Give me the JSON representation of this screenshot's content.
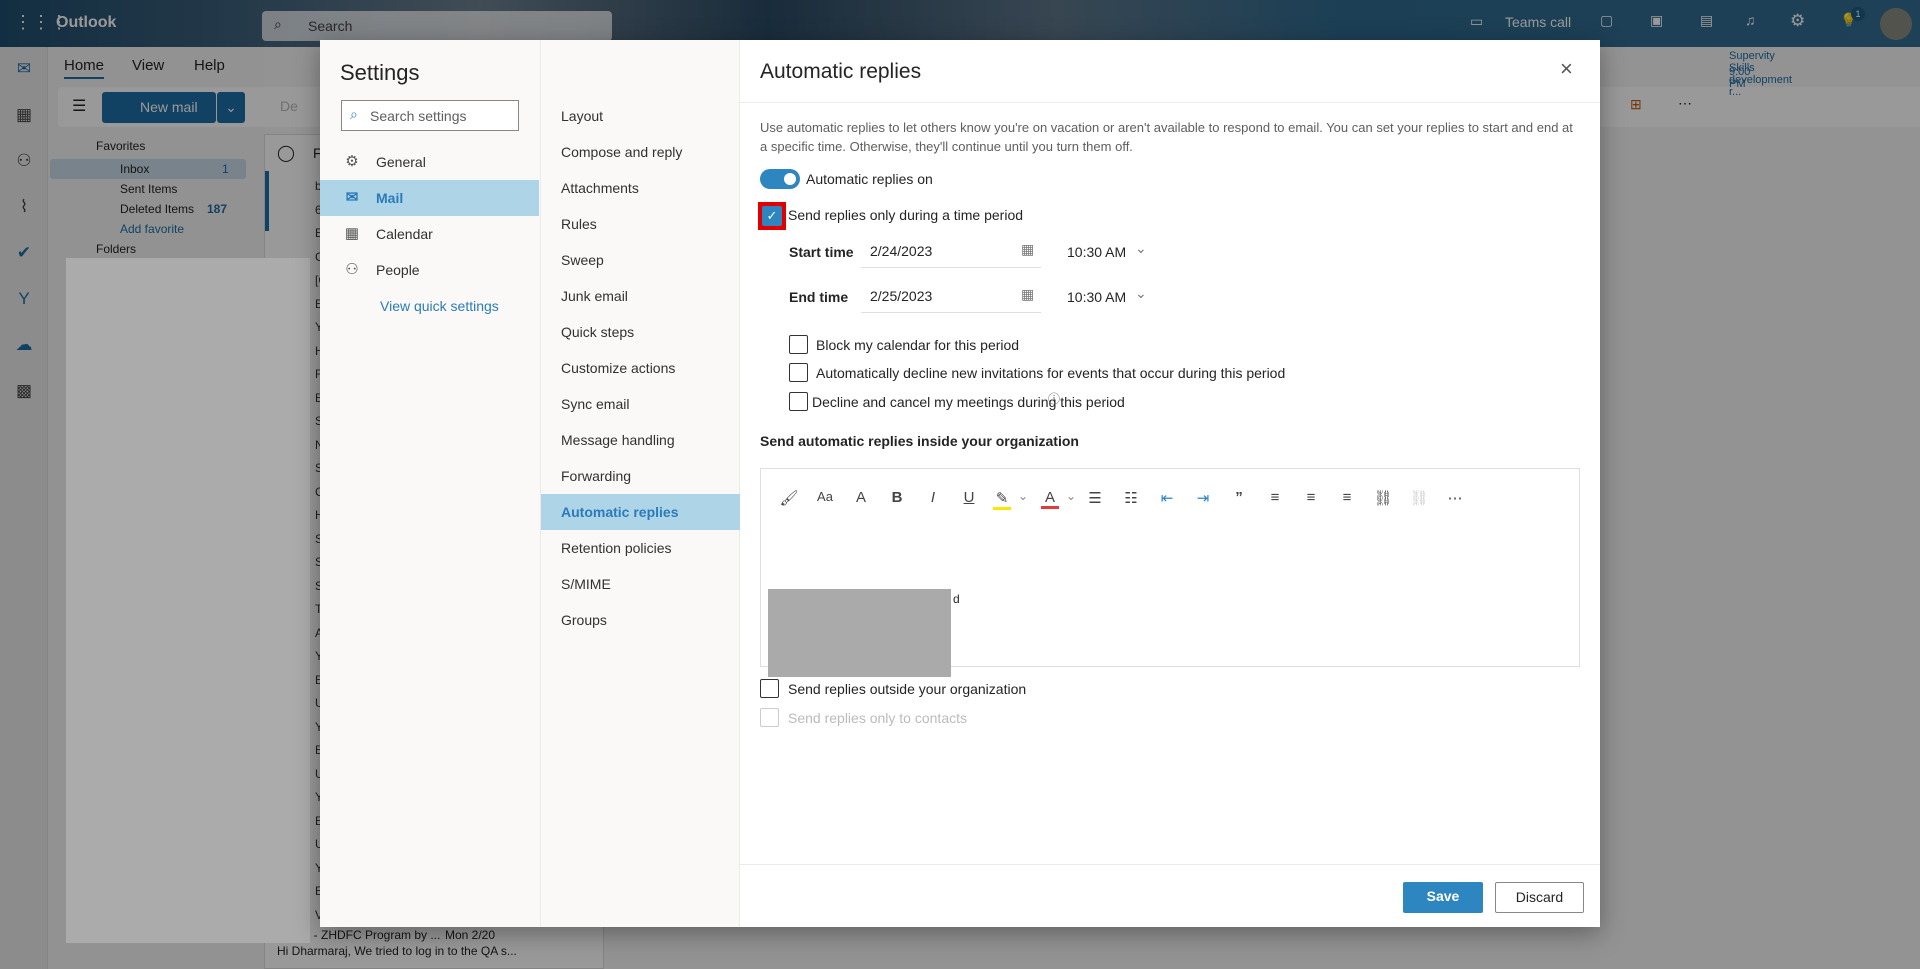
{
  "app": {
    "name": "Outlook",
    "search_placeholder": "Search"
  },
  "topbar": {
    "teams_call": "Teams call",
    "tips_badge": "1"
  },
  "reminder": {
    "title": "Supervity Skills development r...",
    "time": "9:00 PM"
  },
  "ribbon": {
    "tabs": [
      "Home",
      "View",
      "Help"
    ],
    "new_mail": "New mail",
    "delete_partial": "De"
  },
  "folders": {
    "favorites": "Favorites",
    "items": [
      {
        "label": "Inbox",
        "count": "1"
      },
      {
        "label": "Sent Items",
        "count": ""
      },
      {
        "label": "Deleted Items",
        "count": "187"
      }
    ],
    "add_favorite": "Add favorite",
    "folders_label": "Folders"
  },
  "message_list": {
    "filter_partial": "F",
    "row_initials": [
      "b",
      "6",
      "E",
      "G",
      "[C",
      "E",
      "Yo",
      "H",
      "Fe",
      "E",
      "S",
      "N",
      "S",
      "C",
      "H",
      "S",
      "S",
      "S",
      "Th",
      "A",
      "Yo",
      "E",
      "U",
      "Yo",
      "E",
      "U",
      "Yo",
      "E",
      "U",
      "Yo",
      "E",
      "V"
    ],
    "last": {
      "subject": "UKSC - ZHDFC Program by ...",
      "date": "Mon 2/20",
      "preview": "Hi Dharmaraj, We tried to log in to the QA s..."
    }
  },
  "settings": {
    "title": "Settings",
    "search_placeholder": "Search settings",
    "categories": [
      {
        "label": "General",
        "icon": "gear-icon"
      },
      {
        "label": "Mail",
        "icon": "mail-icon"
      },
      {
        "label": "Calendar",
        "icon": "calendar-icon"
      },
      {
        "label": "People",
        "icon": "people-icon"
      }
    ],
    "selected_category": "Mail",
    "view_quick_settings": "View quick settings",
    "mail_sections": [
      "Layout",
      "Compose and reply",
      "Attachments",
      "Rules",
      "Sweep",
      "Junk email",
      "Quick steps",
      "Customize actions",
      "Sync email",
      "Message handling",
      "Forwarding",
      "Automatic replies",
      "Retention policies",
      "S/MIME",
      "Groups"
    ],
    "selected_section": "Automatic replies"
  },
  "auto_replies": {
    "title": "Automatic replies",
    "description": "Use automatic replies to let others know you're on vacation or aren't available to respond to email. You can set your replies to start and end at a specific time. Otherwise, they'll continue until you turn them off.",
    "toggle_label": "Automatic replies on",
    "toggle_on": true,
    "time_period_label": "Send replies only during a time period",
    "time_period_checked": true,
    "start_label": "Start time",
    "start_date": "2/24/2023",
    "start_time": "10:30 AM",
    "end_label": "End time",
    "end_date": "2/25/2023",
    "end_time": "10:30 AM",
    "options": [
      "Block my calendar for this period",
      "Automatically decline new invitations for events that occur during this period",
      "Decline and cancel my meetings during this period"
    ],
    "inside_heading": "Send automatic replies inside your organization",
    "editor_visible_text": "d",
    "outside_label": "Send replies outside your organization",
    "contacts_label": "Send replies only to contacts",
    "save": "Save",
    "discard": "Discard"
  },
  "colors": {
    "accent": "#2e86c1",
    "selection": "#aed4e8",
    "highlight_red": "#e00000"
  }
}
